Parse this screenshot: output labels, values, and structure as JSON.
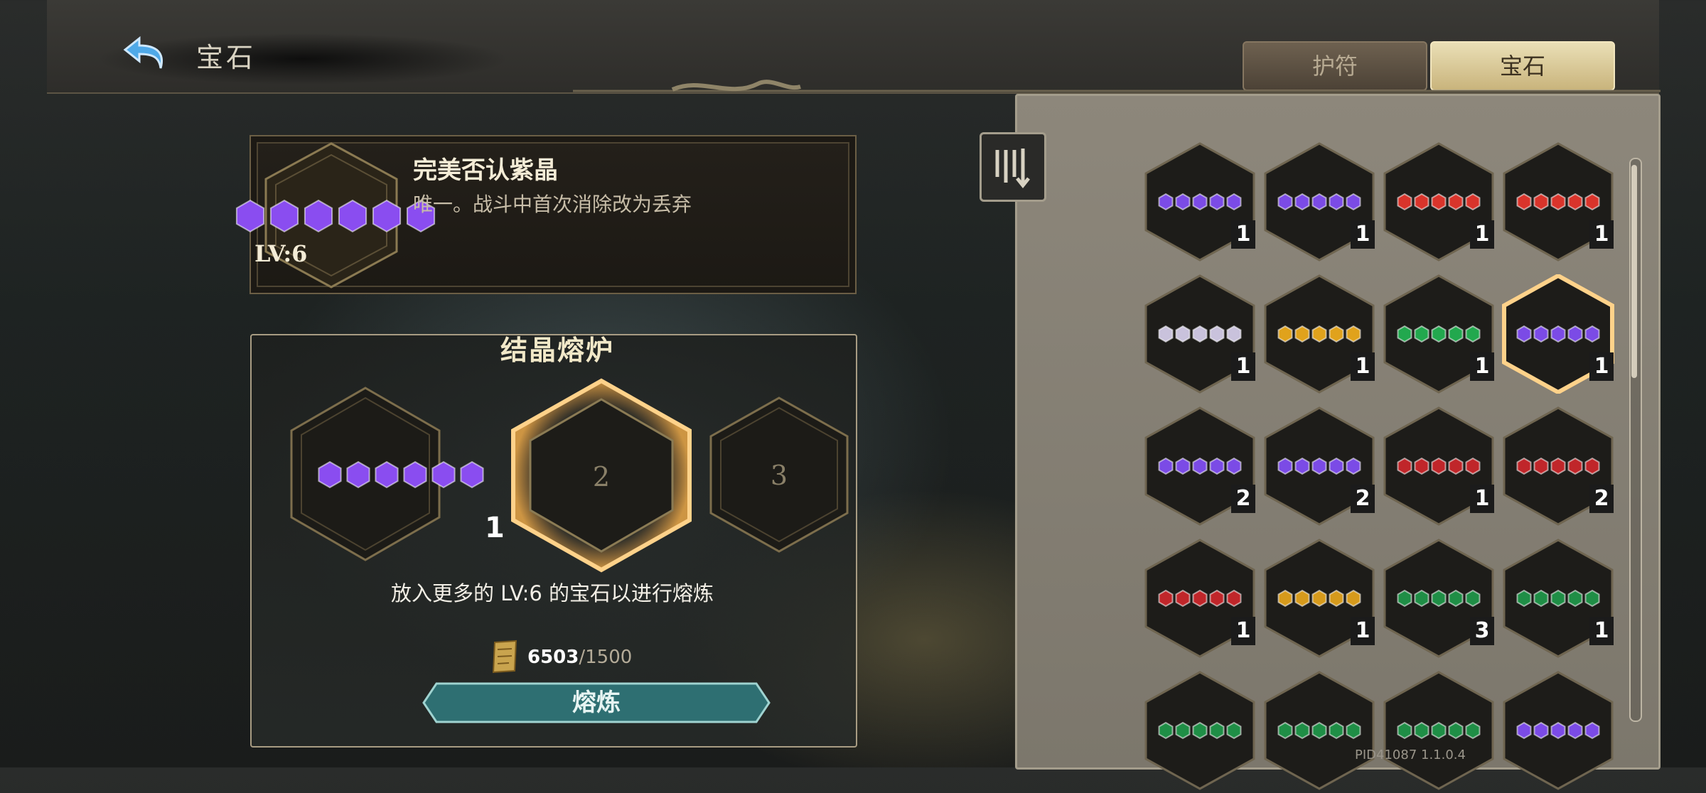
{
  "header": {
    "title": "宝石"
  },
  "tabs": [
    {
      "label": "护符",
      "active": false
    },
    {
      "label": "宝石",
      "active": true
    }
  ],
  "selected_gem": {
    "name": "完美否认紫晶",
    "description": "唯一。战斗中首次消除改为丢弃",
    "level": "LV:6",
    "color": "#8a4df0"
  },
  "furnace": {
    "title": "结晶熔炉",
    "slot1_count": "1",
    "slot2_label": "2",
    "slot3_label": "3",
    "hint": "放入更多的 LV:6 的宝石以进行熔炼",
    "currency_have": "6503",
    "currency_need": "/1500",
    "button_label": "熔炼"
  },
  "inventory": [
    {
      "color": "#7b4be6",
      "count": "1"
    },
    {
      "color": "#7b4be6",
      "count": "1"
    },
    {
      "color": "#d9342b",
      "count": "1"
    },
    {
      "color": "#d9342b",
      "count": "1"
    },
    {
      "color": "#c9c2dc",
      "count": "1"
    },
    {
      "color": "#e0a21c",
      "count": "1"
    },
    {
      "color": "#22a84e",
      "count": "1"
    },
    {
      "color": "#7b4be6",
      "count": "1",
      "selected": true
    },
    {
      "color": "#7b4be6",
      "count": "2"
    },
    {
      "color": "#7b4be6",
      "count": "2"
    },
    {
      "color": "#c0262a",
      "count": "1"
    },
    {
      "color": "#c0262a",
      "count": "2"
    },
    {
      "color": "#c0262a",
      "count": "1"
    },
    {
      "color": "#d69a1c",
      "count": "1"
    },
    {
      "color": "#1f8e46",
      "count": "3"
    },
    {
      "color": "#1f8e46",
      "count": "1"
    },
    {
      "color": "#1f8e46",
      "count": ""
    },
    {
      "color": "#1f8e46",
      "count": ""
    },
    {
      "color": "#1f8e46",
      "count": ""
    },
    {
      "color": "#7b4be6",
      "count": ""
    }
  ],
  "version": "PID41087  1.1.0.4"
}
